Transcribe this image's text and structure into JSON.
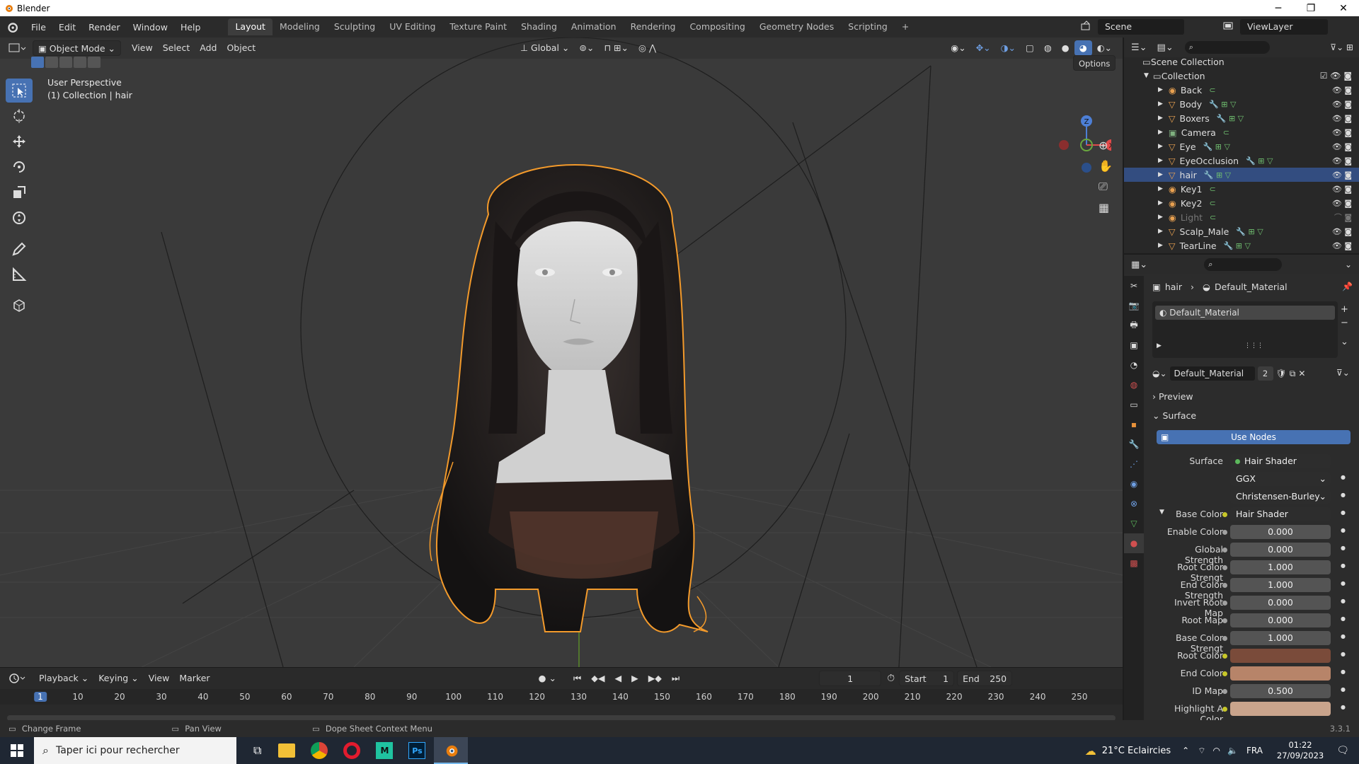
{
  "window": {
    "title": "Blender",
    "min": "─",
    "max": "❐",
    "close": "✕"
  },
  "menu": [
    "File",
    "Edit",
    "Render",
    "Window",
    "Help"
  ],
  "workspaces": [
    "Layout",
    "Modeling",
    "Sculpting",
    "UV Editing",
    "Texture Paint",
    "Shading",
    "Animation",
    "Rendering",
    "Compositing",
    "Geometry Nodes",
    "Scripting"
  ],
  "active_workspace": "Layout",
  "add_workspace": "+",
  "scene": "Scene",
  "view_layer": "ViewLayer",
  "viewport": {
    "mode": "Object Mode",
    "menus": [
      "View",
      "Select",
      "Add",
      "Object"
    ],
    "transform_orientation": "Global",
    "options": "Options",
    "perspective": "User Perspective",
    "collection_info": "(1) Collection | hair",
    "gizmo": {
      "z": "Z",
      "y": "Y",
      "x": "X"
    }
  },
  "timeline": {
    "menus": [
      "Playback",
      "Keying",
      "View",
      "Marker"
    ],
    "current_frame": "1",
    "start_label": "Start",
    "start": "1",
    "end_label": "End",
    "end": "250",
    "ticks": [
      "1",
      "10",
      "20",
      "30",
      "40",
      "50",
      "60",
      "70",
      "80",
      "90",
      "100",
      "110",
      "120",
      "130",
      "140",
      "150",
      "160",
      "170",
      "180",
      "190",
      "200",
      "210",
      "220",
      "230",
      "240",
      "250"
    ]
  },
  "statusbar": {
    "left": "Change Frame",
    "middle": "Pan View",
    "right": "Dope Sheet Context Menu",
    "version": "3.3.1"
  },
  "outliner": {
    "root": "Scene Collection",
    "collection": "Collection",
    "items": [
      {
        "name": "Back",
        "type": "light"
      },
      {
        "name": "Body",
        "type": "mesh"
      },
      {
        "name": "Boxers",
        "type": "mesh"
      },
      {
        "name": "Camera",
        "type": "camera"
      },
      {
        "name": "Eye",
        "type": "mesh"
      },
      {
        "name": "EyeOcclusion",
        "type": "mesh"
      },
      {
        "name": "hair",
        "type": "mesh",
        "selected": true
      },
      {
        "name": "Key1",
        "type": "light"
      },
      {
        "name": "Key2",
        "type": "light"
      },
      {
        "name": "Light",
        "type": "light",
        "hidden": true
      },
      {
        "name": "Scalp_Male",
        "type": "mesh"
      },
      {
        "name": "TearLine",
        "type": "mesh"
      }
    ]
  },
  "properties": {
    "breadcrumb_object": "hair",
    "breadcrumb_material": "Default_Material",
    "slot": "Default_Material",
    "material_name": "Default_Material",
    "user_count": "2",
    "preview": "Preview",
    "surface_section": "Surface",
    "use_nodes": "Use Nodes",
    "surface_label": "Surface",
    "surface_value": "Hair Shader",
    "dist1": "GGX",
    "dist2": "Christensen-Burley",
    "inputs": [
      {
        "label": "Base Color",
        "value": "Hair Shader",
        "kind": "link"
      },
      {
        "label": "Enable Color",
        "value": "0.000",
        "kind": "num"
      },
      {
        "label": "Global Strength",
        "value": "0.000",
        "kind": "num"
      },
      {
        "label": "Root Color Strengt",
        "value": "1.000",
        "kind": "num"
      },
      {
        "label": "End Color Strength",
        "value": "1.000",
        "kind": "num"
      },
      {
        "label": "Invert Root Map",
        "value": "0.000",
        "kind": "num"
      },
      {
        "label": "Root Map",
        "value": "0.000",
        "kind": "num"
      },
      {
        "label": "Base Color Strengt",
        "value": "1.000",
        "kind": "num"
      },
      {
        "label": "Root Color",
        "value": "#7a4b3a",
        "kind": "color"
      },
      {
        "label": "End Color",
        "value": "#b78469",
        "kind": "color"
      },
      {
        "label": "ID Map",
        "value": "0.500",
        "kind": "num"
      },
      {
        "label": "Highlight A Color",
        "value": "#c9a48c",
        "kind": "color"
      }
    ]
  },
  "taskbar": {
    "search_placeholder": "Taper ici pour rechercher",
    "weather": "21°C Eclaircies",
    "lang": "FRA",
    "time": "01:22",
    "date": "27/09/2023"
  },
  "colors": {
    "accent": "#4772b3",
    "selection_outline": "#f39a2b",
    "selected_row": "#334d80"
  }
}
